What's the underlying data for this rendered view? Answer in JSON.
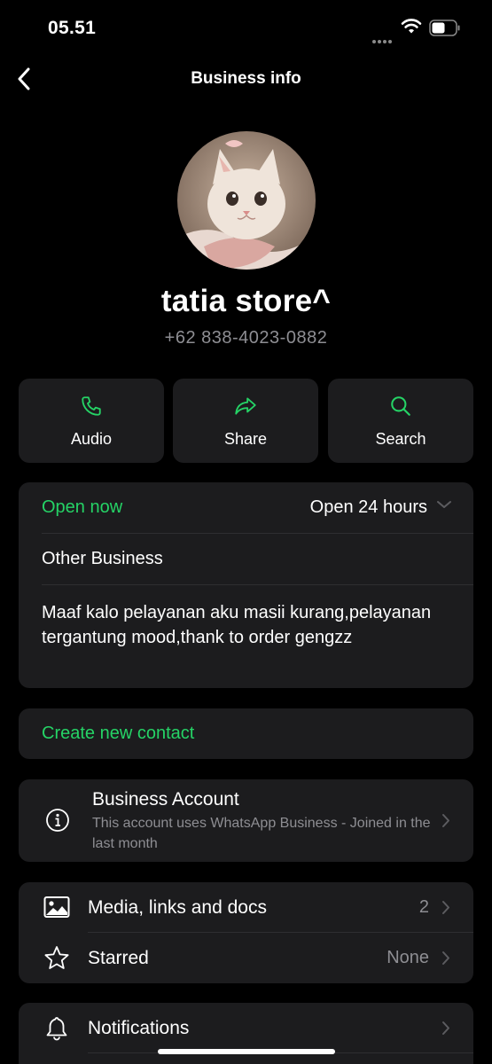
{
  "status_bar": {
    "time": "05.51"
  },
  "nav": {
    "title": "Business info"
  },
  "profile": {
    "name": "tatia store^",
    "phone": "+62 838-4023-0882"
  },
  "actions": [
    {
      "label": "Audio",
      "icon": "phone-icon"
    },
    {
      "label": "Share",
      "icon": "share-arrow-icon"
    },
    {
      "label": "Search",
      "icon": "search-icon"
    }
  ],
  "business_details": {
    "status": "Open now",
    "hours": "Open 24 hours",
    "category": "Other Business",
    "description": "Maaf kalo pelayanan aku masii kurang,pelayanan tergantung mood,thank to order gengzz"
  },
  "contact": {
    "create_label": "Create new contact"
  },
  "business_account": {
    "title": "Business Account",
    "subtitle": "This account uses WhatsApp Business - Joined in the last month"
  },
  "rows": {
    "media": {
      "label": "Media, links and docs",
      "value": "2"
    },
    "starred": {
      "label": "Starred",
      "value": "None"
    },
    "notifications": {
      "label": "Notifications"
    }
  },
  "colors": {
    "accent": "#25d366",
    "card": "#1c1c1e",
    "secondary_text": "#8e8e93",
    "background": "#000000"
  }
}
